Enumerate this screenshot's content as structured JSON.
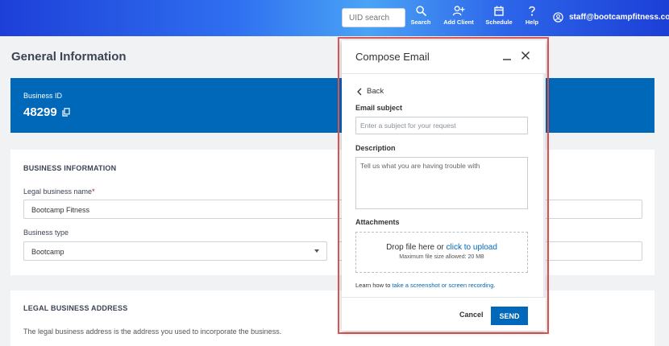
{
  "header": {
    "uid_search_placeholder": "UID search",
    "nav": [
      {
        "label": "Search",
        "icon": "search-icon"
      },
      {
        "label": "Add Client",
        "icon": "add-user-icon"
      },
      {
        "label": "Schedule",
        "icon": "calendar-icon"
      },
      {
        "label": "Help",
        "icon": "help-icon"
      }
    ],
    "user_email": "staff@bootcampfitness.com"
  },
  "page": {
    "title": "General Information",
    "business_id_label": "Business ID",
    "business_id_value": "48299"
  },
  "business_info": {
    "section_title": "BUSINESS INFORMATION",
    "legal_name_label": "Legal business name",
    "required_mark": "*",
    "legal_name_value": "Bootcamp Fitness",
    "business_type_label": "Business type",
    "business_type_value": "Bootcamp"
  },
  "legal_address": {
    "section_title": "LEGAL BUSINESS ADDRESS",
    "description": "The legal business address is the address you used to incorporate the business."
  },
  "modal": {
    "title": "Compose Email",
    "back_label": "Back",
    "subject_label": "Email subject",
    "subject_placeholder": "Enter a subject for your request",
    "description_label": "Description",
    "description_placeholder": "Tell us what you are having trouble with",
    "attachments_label": "Attachments",
    "drop_text": "Drop file here or",
    "upload_link": "click to upload",
    "max_size": "Maximum file size allowed: 20 MB",
    "learn_prefix": "Learn how to",
    "learn_link": "take a screenshot or screen recording",
    "learn_suffix": ".",
    "cancel_label": "Cancel",
    "send_label": "SEND"
  },
  "colors": {
    "brand_blue": "#0068b8",
    "highlight_red": "#e05555"
  }
}
